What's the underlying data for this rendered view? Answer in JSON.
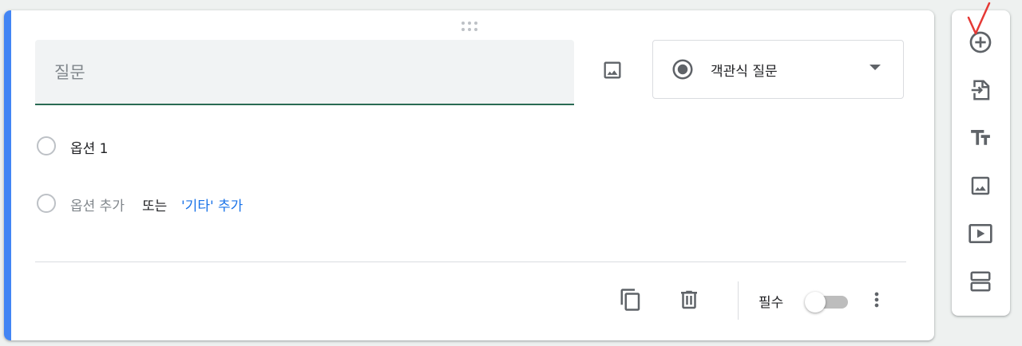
{
  "question": {
    "placeholder": "질문",
    "value": ""
  },
  "question_type": {
    "selected": "객관식 질문",
    "icon": "radio-button-checked-icon"
  },
  "options": [
    {
      "label": "옵션 1"
    }
  ],
  "add_option": {
    "label": "옵션 추가",
    "or_text": "또는",
    "add_other_label": "'기타' 추가"
  },
  "footer": {
    "required_label": "필수",
    "required_on": false,
    "icons": [
      "copy-icon",
      "delete-icon",
      "more-vert-icon"
    ]
  },
  "sidebar": {
    "items": [
      {
        "icon": "add-question-icon"
      },
      {
        "icon": "import-questions-icon"
      },
      {
        "icon": "add-title-icon"
      },
      {
        "icon": "add-image-icon"
      },
      {
        "icon": "add-video-icon"
      },
      {
        "icon": "add-section-icon"
      }
    ]
  },
  "colors": {
    "accent": "#4285f4",
    "field_underline": "#2a6b53",
    "link": "#1a73e8",
    "icon": "#5f6368",
    "annotation": "#e53935"
  }
}
